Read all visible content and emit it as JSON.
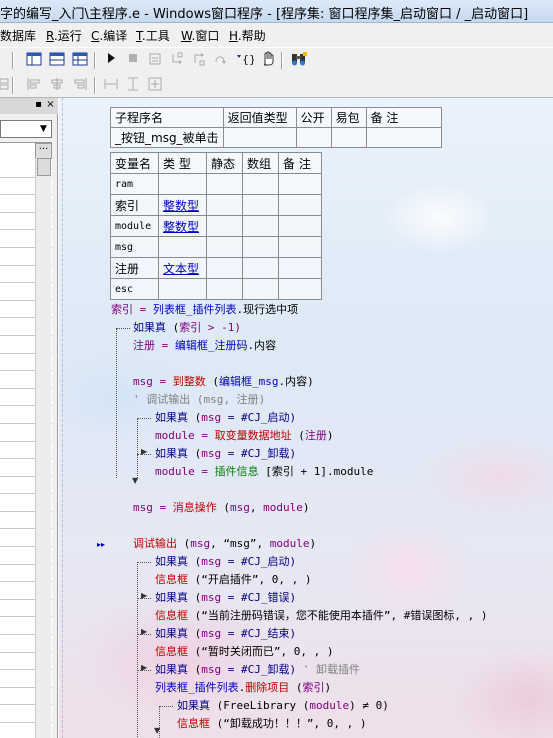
{
  "window": {
    "title": "字的编写_入门\\主程序.e - Windows窗口程序 - [程序集: 窗口程序集_启动窗口 / _启动窗口]"
  },
  "menu": [
    {
      "label": "数据库",
      "key": ""
    },
    {
      "label": "运行",
      "key": "R"
    },
    {
      "label": "编译",
      "key": "C"
    },
    {
      "label": "工具",
      "key": "T"
    },
    {
      "label": "窗口",
      "key": "W"
    },
    {
      "label": "帮助",
      "key": "H"
    }
  ],
  "toolbar": {
    "icons": [
      "table-icon",
      "layout-icon",
      "grid-icon",
      "run-icon",
      "stop-icon",
      "step-icon",
      "step-into-icon",
      "step-out-icon",
      "step-over-icon",
      "braces-icon",
      "hand-icon",
      "binoculars-icon"
    ]
  },
  "leftpanel": {
    "pin": "▪",
    "close": "×",
    "combo_arrow": "▼",
    "grid_btn": "···"
  },
  "sub": {
    "headers": [
      "子程序名",
      "返回值类型",
      "公开",
      "易包",
      "备 注"
    ],
    "name": "_按钮_msg_被单击"
  },
  "vars": {
    "headers": [
      "变量名",
      "类 型",
      "静态",
      "数组",
      "备 注"
    ],
    "rows": [
      {
        "name": "ram",
        "type": ""
      },
      {
        "name": "索引",
        "type": "整数型"
      },
      {
        "name": "module",
        "type": "整数型"
      },
      {
        "name": "msg",
        "type": ""
      },
      {
        "name": "注册",
        "type": "文本型"
      },
      {
        "name": "esc",
        "type": ""
      }
    ]
  },
  "code": {
    "l1": [
      "索引",
      " = ",
      "列表框_插件列表",
      ".现行选中项"
    ],
    "l2": [
      "如果真",
      " (",
      "索引",
      " > -1)"
    ],
    "l3": [
      "注册",
      " = ",
      "编辑框_注册码",
      ".内容"
    ],
    "l4": [
      "msg",
      " = ",
      "到整数",
      " (",
      "编辑框_msg",
      ".内容)"
    ],
    "l5": [
      "' ",
      "调试输出",
      " (msg, 注册)"
    ],
    "l6": [
      "如果真",
      " (",
      "msg",
      " = #CJ_启动)"
    ],
    "l7": [
      "module",
      " = ",
      "取变量数据地址",
      " (",
      "注册",
      ")"
    ],
    "l8": [
      "如果真",
      " (",
      "msg",
      " = #CJ_卸载)"
    ],
    "l9": [
      "module",
      " = ",
      "插件信息",
      " [索引 + 1].module"
    ],
    "l10": [
      "msg",
      " = ",
      "消息操作",
      " (",
      "msg",
      ", ",
      "module",
      ")"
    ],
    "l11": [
      "调试输出",
      " (",
      "msg",
      ", “msg”, ",
      "module",
      ")"
    ],
    "l12": [
      "如果真",
      " (",
      "msg",
      " = #CJ_启动)"
    ],
    "l13": [
      "信息框",
      " (“开启插件”, 0, , )"
    ],
    "l14": [
      "如果真",
      " (",
      "msg",
      " = #CJ_错误)"
    ],
    "l15": [
      "信息框",
      " (“当前注册码错误，您不能使用本插件”, #错误图标, , )"
    ],
    "l16": [
      "如果真",
      " (",
      "msg",
      " = #CJ_结束)"
    ],
    "l17": [
      "信息框",
      " (“暂时关闭而已”, 0, , )"
    ],
    "l18": [
      "如果真",
      " (",
      "msg",
      " = #CJ_卸载) ",
      "' 卸载插件"
    ],
    "l19": [
      "列表框_插件列表",
      ".",
      "删除项目",
      " (",
      "索引",
      ")"
    ],
    "l20": [
      "如果真",
      " (FreeLibrary (",
      "module",
      ") ≠ 0)"
    ],
    "l21": [
      "信息框",
      " (“卸载成功！！！”, 0, , )"
    ]
  },
  "markers": {
    "breakpoint": "▸▸"
  }
}
